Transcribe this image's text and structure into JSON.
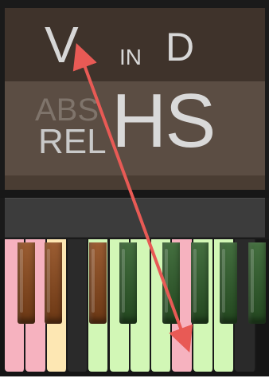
{
  "header": {
    "v_label": "V",
    "in_label": "IN",
    "d_label": "D",
    "abs_label": "ABS",
    "rel_label": "REL",
    "hs_label": "HS"
  },
  "keyboard": {
    "white_keys": [
      {
        "color": "#f6b2bf"
      },
      {
        "color": "#f6b2bf"
      },
      {
        "color": "#fde7b3"
      },
      {
        "color": "#2a2a2a"
      },
      {
        "color": "#d2f7b6"
      },
      {
        "color": "#d2f7b6"
      },
      {
        "color": "#d2f7b6"
      },
      {
        "color": "#d2f7b6"
      },
      {
        "color": "#f6b2bf"
      },
      {
        "color": "#d2f7b6"
      },
      {
        "color": "#d2f7b6"
      },
      {
        "color": "#2a2a2a"
      }
    ],
    "black_keys": [
      {
        "color": "#8f4a1b"
      },
      {
        "color": "#8f4a1b"
      },
      {
        "color": "#8f4a1b"
      },
      {
        "color": "#2f5f2a"
      },
      {
        "color": "#2f5f2a"
      },
      {
        "color": "#2f5f2a"
      },
      {
        "color": "#2f5f2a"
      },
      {
        "color": "#2f5f2a"
      }
    ]
  },
  "annotation": {
    "arrow_color": "#e85a55"
  }
}
